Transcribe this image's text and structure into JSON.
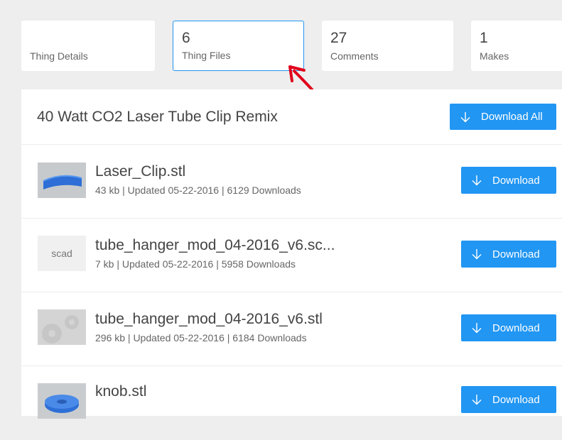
{
  "tabs": [
    {
      "count": "",
      "label": "Thing Details"
    },
    {
      "count": "6",
      "label": "Thing Files"
    },
    {
      "count": "27",
      "label": "Comments"
    },
    {
      "count": "1",
      "label": "Makes"
    }
  ],
  "panel": {
    "title": "40 Watt CO2 Laser Tube Clip Remix",
    "download_all_label": "Download All"
  },
  "files": [
    {
      "name": "Laser_Clip.stl",
      "meta": "43 kb | Updated 05-22-2016 | 6129 Downloads",
      "thumb": "",
      "download_label": "Download"
    },
    {
      "name": "tube_hanger_mod_04-2016_v6.sc...",
      "meta": "7 kb | Updated 05-22-2016 | 5958 Downloads",
      "thumb": "scad",
      "download_label": "Download"
    },
    {
      "name": "tube_hanger_mod_04-2016_v6.stl",
      "meta": "296 kb | Updated 05-22-2016 | 6184 Downloads",
      "thumb": "",
      "download_label": "Download"
    },
    {
      "name": "knob.stl",
      "meta": "",
      "thumb": "",
      "download_label": "Download"
    }
  ],
  "colors": {
    "accent": "#2196f3",
    "annotation": "#e0001a"
  },
  "icons": {
    "download": "arrow-down-icon",
    "annotation": "red-arrow-annotation"
  }
}
